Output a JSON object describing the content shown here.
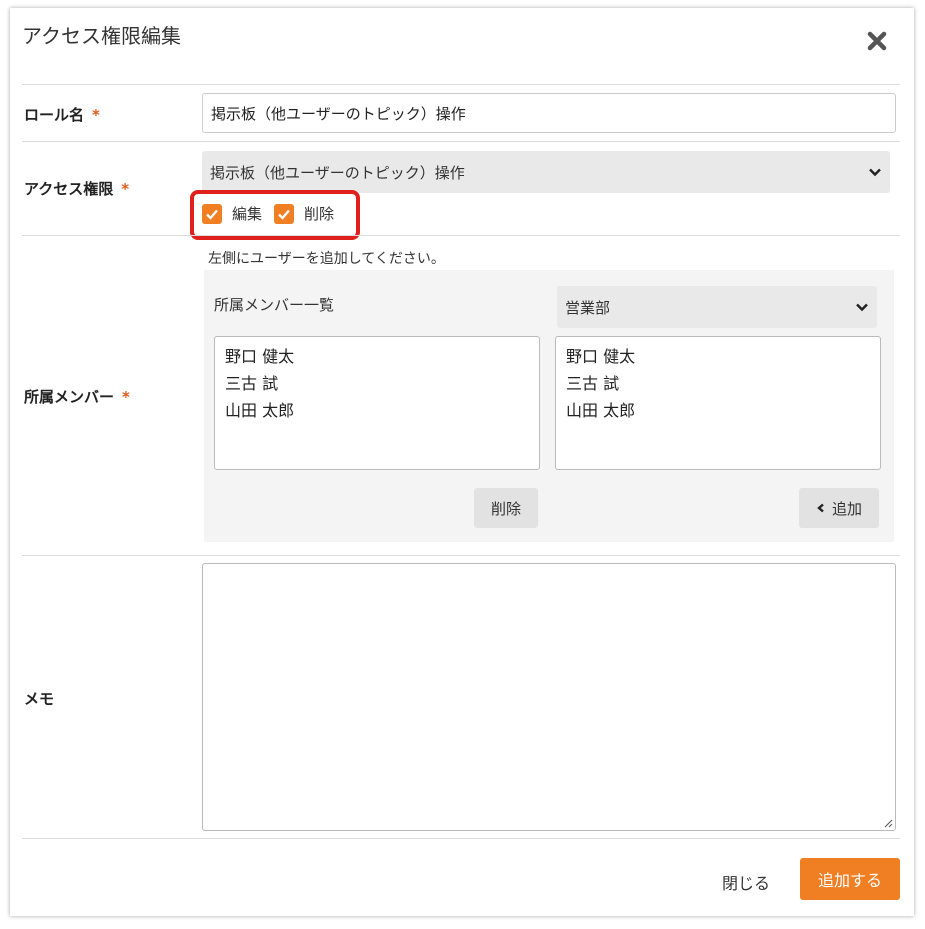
{
  "dialog": {
    "title": "アクセス権限編集"
  },
  "colors": {
    "accent": "#f07e22",
    "required": "#e05a1e",
    "highlight": "#e0201b"
  },
  "role_name": {
    "label": "ロール名",
    "required_mark": "*",
    "value": "掲示板（他ユーザーのトピック）操作"
  },
  "access": {
    "label": "アクセス権限",
    "required_mark": "*",
    "selected": "掲示板（他ユーザーのトピック）操作",
    "checkboxes": [
      {
        "label": "編集",
        "checked": true
      },
      {
        "label": "削除",
        "checked": true
      }
    ]
  },
  "members": {
    "label": "所属メンバー",
    "required_mark": "*",
    "hint": "左側にユーザーを追加してください。",
    "list_title": "所属メンバー一覧",
    "department_selected": "営業部",
    "left_list": [
      "野口 健太",
      "三古 試",
      "山田 太郎"
    ],
    "right_list": [
      "野口 健太",
      "三古 試",
      "山田 太郎"
    ],
    "delete_button": "削除",
    "add_button": "追加"
  },
  "memo": {
    "label": "メモ",
    "value": ""
  },
  "footer": {
    "close_label": "閉じる",
    "submit_label": "追加する"
  }
}
